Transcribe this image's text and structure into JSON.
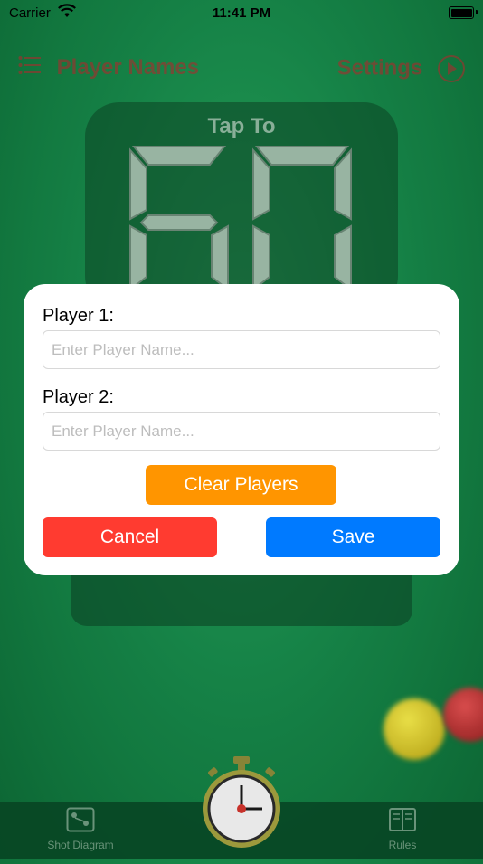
{
  "status_bar": {
    "carrier": "Carrier",
    "time": "11:41 PM"
  },
  "nav": {
    "left_label": "Player Names",
    "right_label": "Settings"
  },
  "timer": {
    "tap_label": "Tap To",
    "display_value": "60"
  },
  "tab_bar": {
    "left_label": "Shot Diagram",
    "right_label": "Rules"
  },
  "dialog": {
    "player1_label": "Player 1:",
    "player1_placeholder": "Enter Player Name...",
    "player1_value": "",
    "player2_label": "Player 2:",
    "player2_placeholder": "Enter Player Name...",
    "player2_value": "",
    "clear_button": "Clear Players",
    "cancel_button": "Cancel",
    "save_button": "Save"
  },
  "colors": {
    "clear": "#ff9500",
    "cancel": "#ff3b30",
    "save": "#007aff",
    "nav_text": "#c0262e"
  },
  "icons": [
    "wifi-icon",
    "battery-icon",
    "list-icon",
    "play-circle-icon",
    "diagram-icon",
    "stopwatch-icon",
    "book-icon"
  ]
}
